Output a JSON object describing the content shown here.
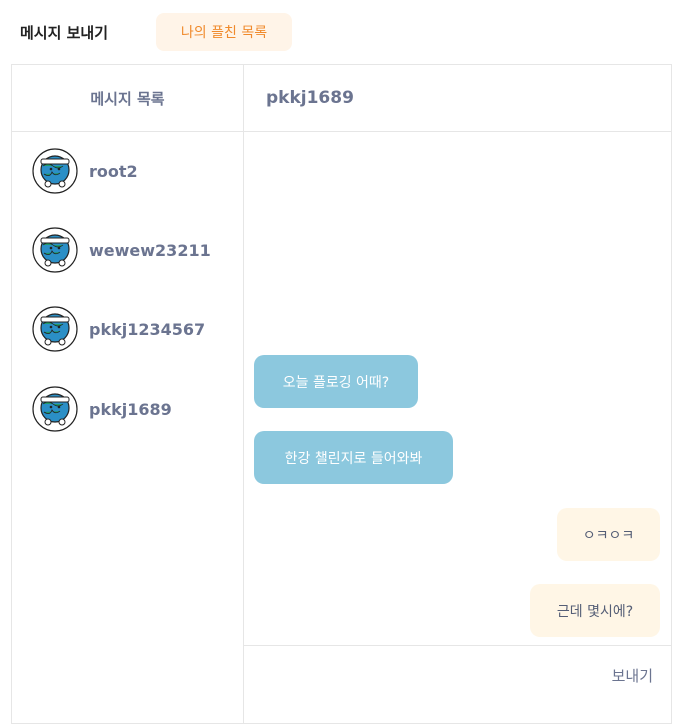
{
  "header": {
    "title": "메시지 보내기",
    "followers_tab": "나의 플친 목록",
    "accent_color": "#f08a2c"
  },
  "sidebar": {
    "title": "메시지 목록",
    "contacts": [
      {
        "name": "root2",
        "avatar_icon": "earth-mascot-icon"
      },
      {
        "name": "wewew23211",
        "avatar_icon": "earth-mascot-icon"
      },
      {
        "name": "pkkj1234567",
        "avatar_icon": "earth-mascot-icon"
      },
      {
        "name": "pkkj1689",
        "avatar_icon": "earth-mascot-icon"
      }
    ]
  },
  "chat": {
    "partner": "pkkj1689",
    "messages": [
      {
        "text": "오늘 플로깅 어때?",
        "direction": "incoming"
      },
      {
        "text": "한강 챌린지로 들어와봐",
        "direction": "incoming"
      },
      {
        "text": "ㅇㅋㅇㅋ",
        "direction": "outgoing"
      },
      {
        "text": "근데 몇시에?",
        "direction": "outgoing"
      }
    ],
    "incoming_color": "#8cc8de",
    "outgoing_color": "#fff6e6"
  },
  "composer": {
    "input_value": "",
    "send_label": "보내기"
  }
}
